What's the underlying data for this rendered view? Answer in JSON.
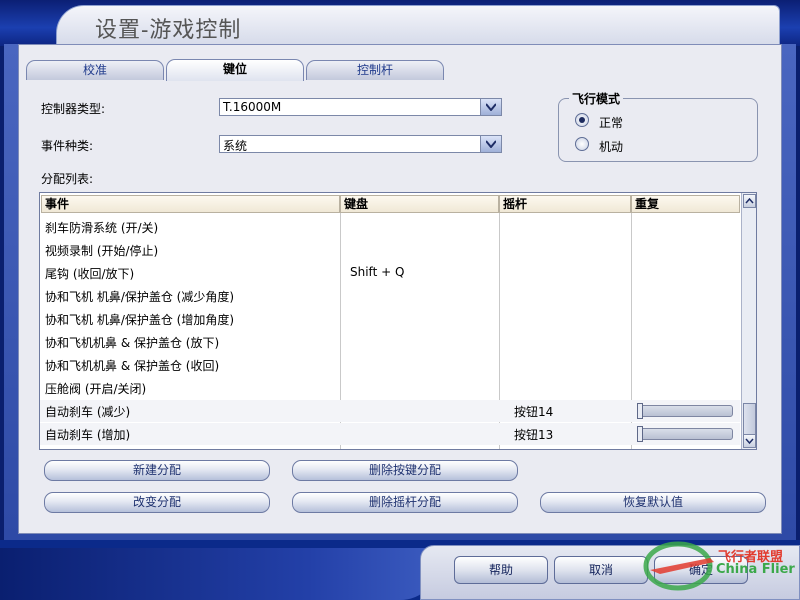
{
  "window": {
    "title": "设置-游戏控制"
  },
  "tabs": [
    {
      "label": "校准"
    },
    {
      "label": "键位"
    },
    {
      "label": "控制杆"
    }
  ],
  "controller_type": {
    "label": "控制器类型:",
    "value": "T.16000M"
  },
  "event_category": {
    "label": "事件种类:",
    "value": "系统"
  },
  "flight_mode": {
    "title": "飞行模式",
    "options": [
      {
        "label": "正常",
        "selected": true
      },
      {
        "label": "机动",
        "selected": false
      }
    ]
  },
  "assignment_list": {
    "label": "分配列表:",
    "columns": [
      "事件",
      "键盘",
      "摇杆",
      "重复"
    ],
    "rows": [
      {
        "event": "刹车防滑系统 (开/关)",
        "keyboard": "",
        "joystick": ""
      },
      {
        "event": "视频录制 (开始/停止)",
        "keyboard": "",
        "joystick": ""
      },
      {
        "event": "尾钩 (收回/放下)",
        "keyboard": "Shift + Q",
        "joystick": ""
      },
      {
        "event": "协和飞机 机鼻/保护盖仓 (减少角度)",
        "keyboard": "",
        "joystick": ""
      },
      {
        "event": "协和飞机 机鼻/保护盖仓 (增加角度)",
        "keyboard": "",
        "joystick": ""
      },
      {
        "event": "协和飞机机鼻 & 保护盖仓 (放下)",
        "keyboard": "",
        "joystick": ""
      },
      {
        "event": "协和飞机机鼻 & 保护盖仓 (收回)",
        "keyboard": "",
        "joystick": ""
      },
      {
        "event": "压舱阀 (开启/关闭)",
        "keyboard": "",
        "joystick": ""
      },
      {
        "event": "自动刹车 (减少)",
        "keyboard": "",
        "joystick": "按钮14",
        "repeat": 0
      },
      {
        "event": "自动刹车 (增加)",
        "keyboard": "",
        "joystick": "按钮13",
        "repeat": 0
      }
    ]
  },
  "buttons": {
    "new_assignment": "新建分配",
    "delete_key_assignment": "删除按键分配",
    "change_assignment": "改变分配",
    "delete_joystick_assignment": "删除摇杆分配",
    "restore_defaults": "恢复默认值",
    "help": "帮助",
    "cancel": "取消",
    "ok": "确定"
  },
  "watermark": {
    "name": "飞行者联盟",
    "sub": "China Flier"
  },
  "colors": {
    "frame_blue": "#0b2a8a",
    "header_beige": "#f0e8d6",
    "accent": "#1f3270"
  }
}
